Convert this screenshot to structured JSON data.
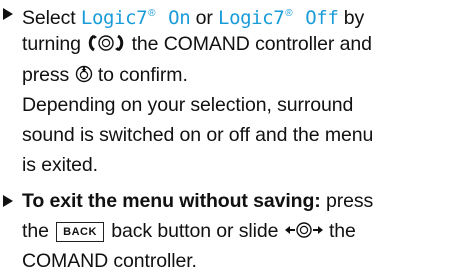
{
  "steps": [
    {
      "line1": {
        "prefix": "Select ",
        "option_on": "Logic7",
        "option_on_suffix": " On",
        "registered": "®",
        "or_text": " or ",
        "option_off": "Logic7",
        "option_off_suffix": " Off",
        "by_text": " by"
      },
      "line2": {
        "turning": "turning ",
        "rest": " the COMAND controller and"
      },
      "line3": {
        "press": "press ",
        "to_confirm": " to confirm."
      },
      "result_lines": [
        "Depending on your selection, surround",
        "sound is switched on or off and the menu",
        "is exited."
      ]
    },
    {
      "line1": {
        "bold_text": "To exit the menu without saving:",
        "rest": " press"
      },
      "line2": {
        "the": "the ",
        "back_key_label": "BACK",
        "back_text": " back button or slide ",
        "the_after": " the"
      },
      "line3": "COMAND controller."
    }
  ],
  "colors": {
    "option_text": "#1a9cd8",
    "body_text": "#111111"
  },
  "icons": {
    "bullet": "triangle-bullet-icon",
    "turn": "controller-turn-icon",
    "press": "controller-press-icon",
    "slide": "controller-slide-icon"
  }
}
